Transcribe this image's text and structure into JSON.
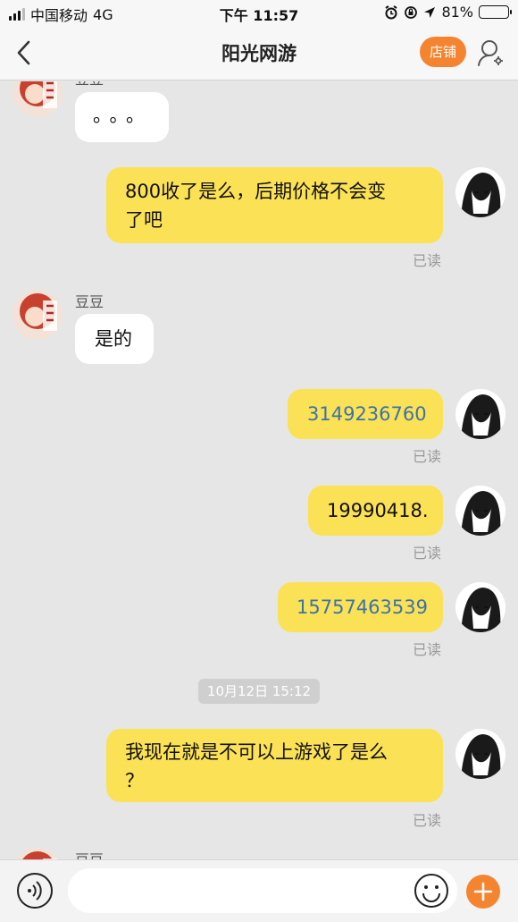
{
  "status_bar": {
    "carrier": "中国移动",
    "network": "4G",
    "time": "下午 11:57",
    "battery": "81%",
    "battery_level": 0.81
  },
  "nav": {
    "title": "阳光网游",
    "shop_label": "店铺",
    "icons": [
      "chevron-left-icon",
      "profile-icon"
    ]
  },
  "messages": [
    {
      "side": "in",
      "sender": "豆豆",
      "text": "。。。"
    },
    {
      "side": "out",
      "line1": "800收了是么，后期价格不会变",
      "line2": "了吧",
      "status": "已读"
    },
    {
      "side": "in",
      "sender": "豆豆",
      "text": "是的"
    },
    {
      "side": "out",
      "text": "3149236760",
      "status": "已读"
    },
    {
      "side": "out",
      "text": "19990418.",
      "status": "已读"
    },
    {
      "side": "out",
      "text": "15757463539",
      "status": "已读"
    },
    {
      "side": "out",
      "line1": "我现在就是不可以上游戏了是么",
      "line2": "？",
      "status": "已读"
    },
    {
      "side": "in",
      "sender": "豆豆"
    }
  ],
  "timestamp": "10月12日 15:12",
  "input_bar": {
    "placeholder": "",
    "icons": [
      "voice-icon",
      "emoji-icon",
      "plus-icon"
    ]
  },
  "colors": {
    "accent": "#f58431",
    "outgoing_bubble": "#fbe156",
    "incoming_bubble": "#ffffff",
    "background": "#e6e6e6",
    "link": "#3b73a8"
  }
}
